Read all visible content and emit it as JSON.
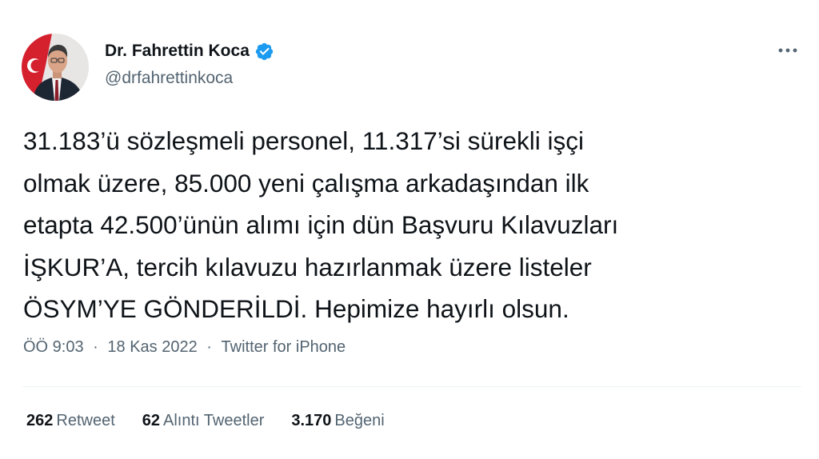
{
  "author": {
    "name": "Dr. Fahrettin Koca",
    "handle": "@drfahrettinkoca",
    "verified": true,
    "verified_icon": "verified-badge-icon",
    "avatar_icon": "profile-photo"
  },
  "more_icon": "more-horizontal-icon",
  "tweet": {
    "lines": [
      "31.183’ü sözleşmeli personel, 11.317’si sürekli işçi",
      "olmak üzere, 85.000 yeni çalışma arkadaşından ilk",
      "etapta 42.500’ünün alımı için dün Başvuru Kılavuzları",
      "İŞKUR’A, tercih kılavuzu hazırlanmak üzere listeler",
      "ÖSYM’YE GÖNDERİLDİ. Hepimize hayırlı olsun."
    ]
  },
  "meta": {
    "time": "ÖÖ 9:03",
    "date": "18 Kas 2022",
    "separator": "·",
    "source": "Twitter for iPhone"
  },
  "stats": [
    {
      "count": "262",
      "label": "Retweet"
    },
    {
      "count": "62",
      "label": "Alıntı Tweetler"
    },
    {
      "count": "3.170",
      "label": "Beğeni"
    }
  ],
  "colors": {
    "primary_text": "#0f1419",
    "secondary_text": "#536471",
    "verified_blue": "#1d9bf0",
    "divider": "#eff3f4",
    "background": "#ffffff"
  }
}
